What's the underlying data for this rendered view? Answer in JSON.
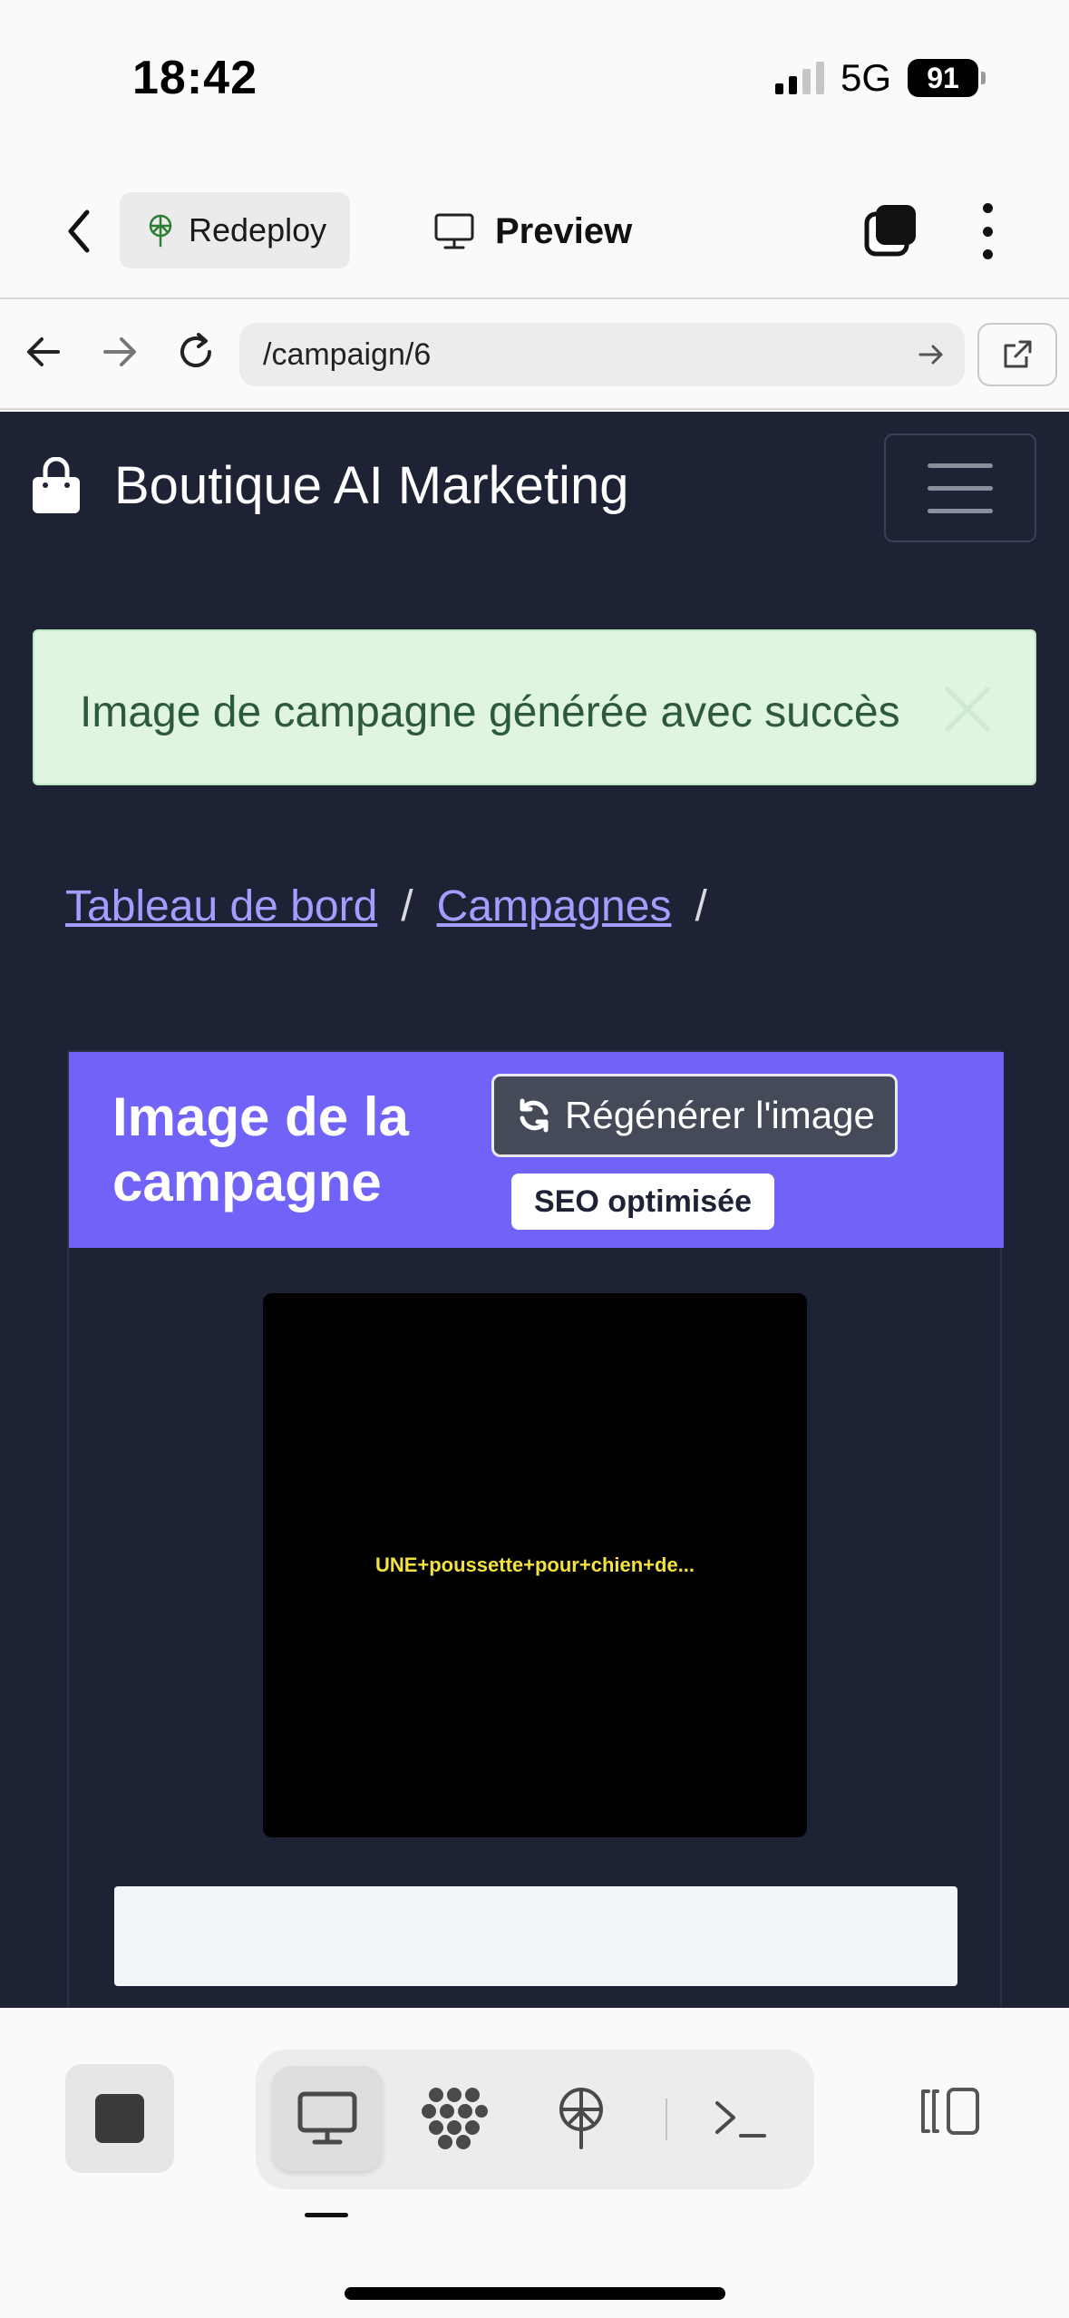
{
  "status_bar": {
    "time": "18:42",
    "network": "5G",
    "battery": "91"
  },
  "app_toolbar": {
    "redeploy_label": "Redeploy",
    "preview_label": "Preview"
  },
  "browser": {
    "url": "/campaign/6"
  },
  "navbar": {
    "brand": "Boutique AI Marketing",
    "brand_icon": "shopping-bag-icon",
    "menu_icon": "hamburger-menu-icon"
  },
  "alert": {
    "message": "Image de campagne générée avec succès",
    "color": "#dff5e2"
  },
  "breadcrumb": {
    "items": [
      "Tableau de bord",
      "Campagnes"
    ],
    "separator": "/"
  },
  "card": {
    "title": "Image de la campagne",
    "regenerate_label": "Régénérer l'image",
    "seo_badge": "SEO optimisée",
    "image_caption": "UNE+poussette+pour+chien+de...",
    "header_color": "#7163f7"
  },
  "bottom_bar": {
    "items": [
      "stop-icon",
      "monitor-icon",
      "cluster-icon",
      "deploy-icon",
      "terminal-icon",
      "panel-toggle-icon"
    ],
    "active": "monitor-icon"
  },
  "colors": {
    "page_background": "#1e2235",
    "link": "#a69cff",
    "caption": "#f4e23c"
  }
}
